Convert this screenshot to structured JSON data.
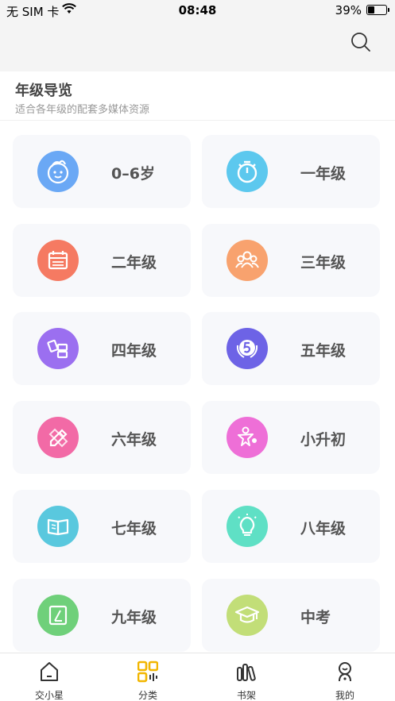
{
  "status_bar": {
    "carrier": "无 SIM 卡",
    "time": "08:48",
    "battery_percent": "39%",
    "battery_level": 0.39
  },
  "nav": {
    "search_icon": "search-icon"
  },
  "section": {
    "title": "年级导览",
    "subtitle": "适合各年级的配套多媒体资源"
  },
  "grades": [
    {
      "label": "0–6岁",
      "icon": "baby-face-icon",
      "color": "#6aa8f5"
    },
    {
      "label": "一年级",
      "icon": "stopwatch-icon",
      "color": "#5cc8ee"
    },
    {
      "label": "二年级",
      "icon": "calendar-icon",
      "color": "#f57a62"
    },
    {
      "label": "三年级",
      "icon": "group-icon",
      "color": "#f8a26e"
    },
    {
      "label": "四年级",
      "icon": "blocks-icon",
      "color": "#9b6ff0"
    },
    {
      "label": "五年级",
      "icon": "number-five-badge-icon",
      "color": "#6d63e6"
    },
    {
      "label": "六年级",
      "icon": "pencil-ruler-icon",
      "color": "#f26aa6"
    },
    {
      "label": "小升初",
      "icon": "star-person-icon",
      "color": "#ee6fd7"
    },
    {
      "label": "七年级",
      "icon": "open-book-icon",
      "color": "#59c8de"
    },
    {
      "label": "八年级",
      "icon": "lightbulb-icon",
      "color": "#5fe0c5"
    },
    {
      "label": "九年级",
      "icon": "notebook-icon",
      "color": "#6fd07a"
    },
    {
      "label": "中考",
      "icon": "graduation-cap-icon",
      "color": "#c2de78"
    }
  ],
  "tabs": [
    {
      "label": "交小星",
      "icon": "home-icon",
      "active": false
    },
    {
      "label": "分类",
      "icon": "category-grid-icon",
      "active": true
    },
    {
      "label": "书架",
      "icon": "bookshelf-icon",
      "active": false
    },
    {
      "label": "我的",
      "icon": "profile-icon",
      "active": false
    }
  ],
  "colors": {
    "active_tab": "#f2b600",
    "tab_default": "#333333"
  }
}
